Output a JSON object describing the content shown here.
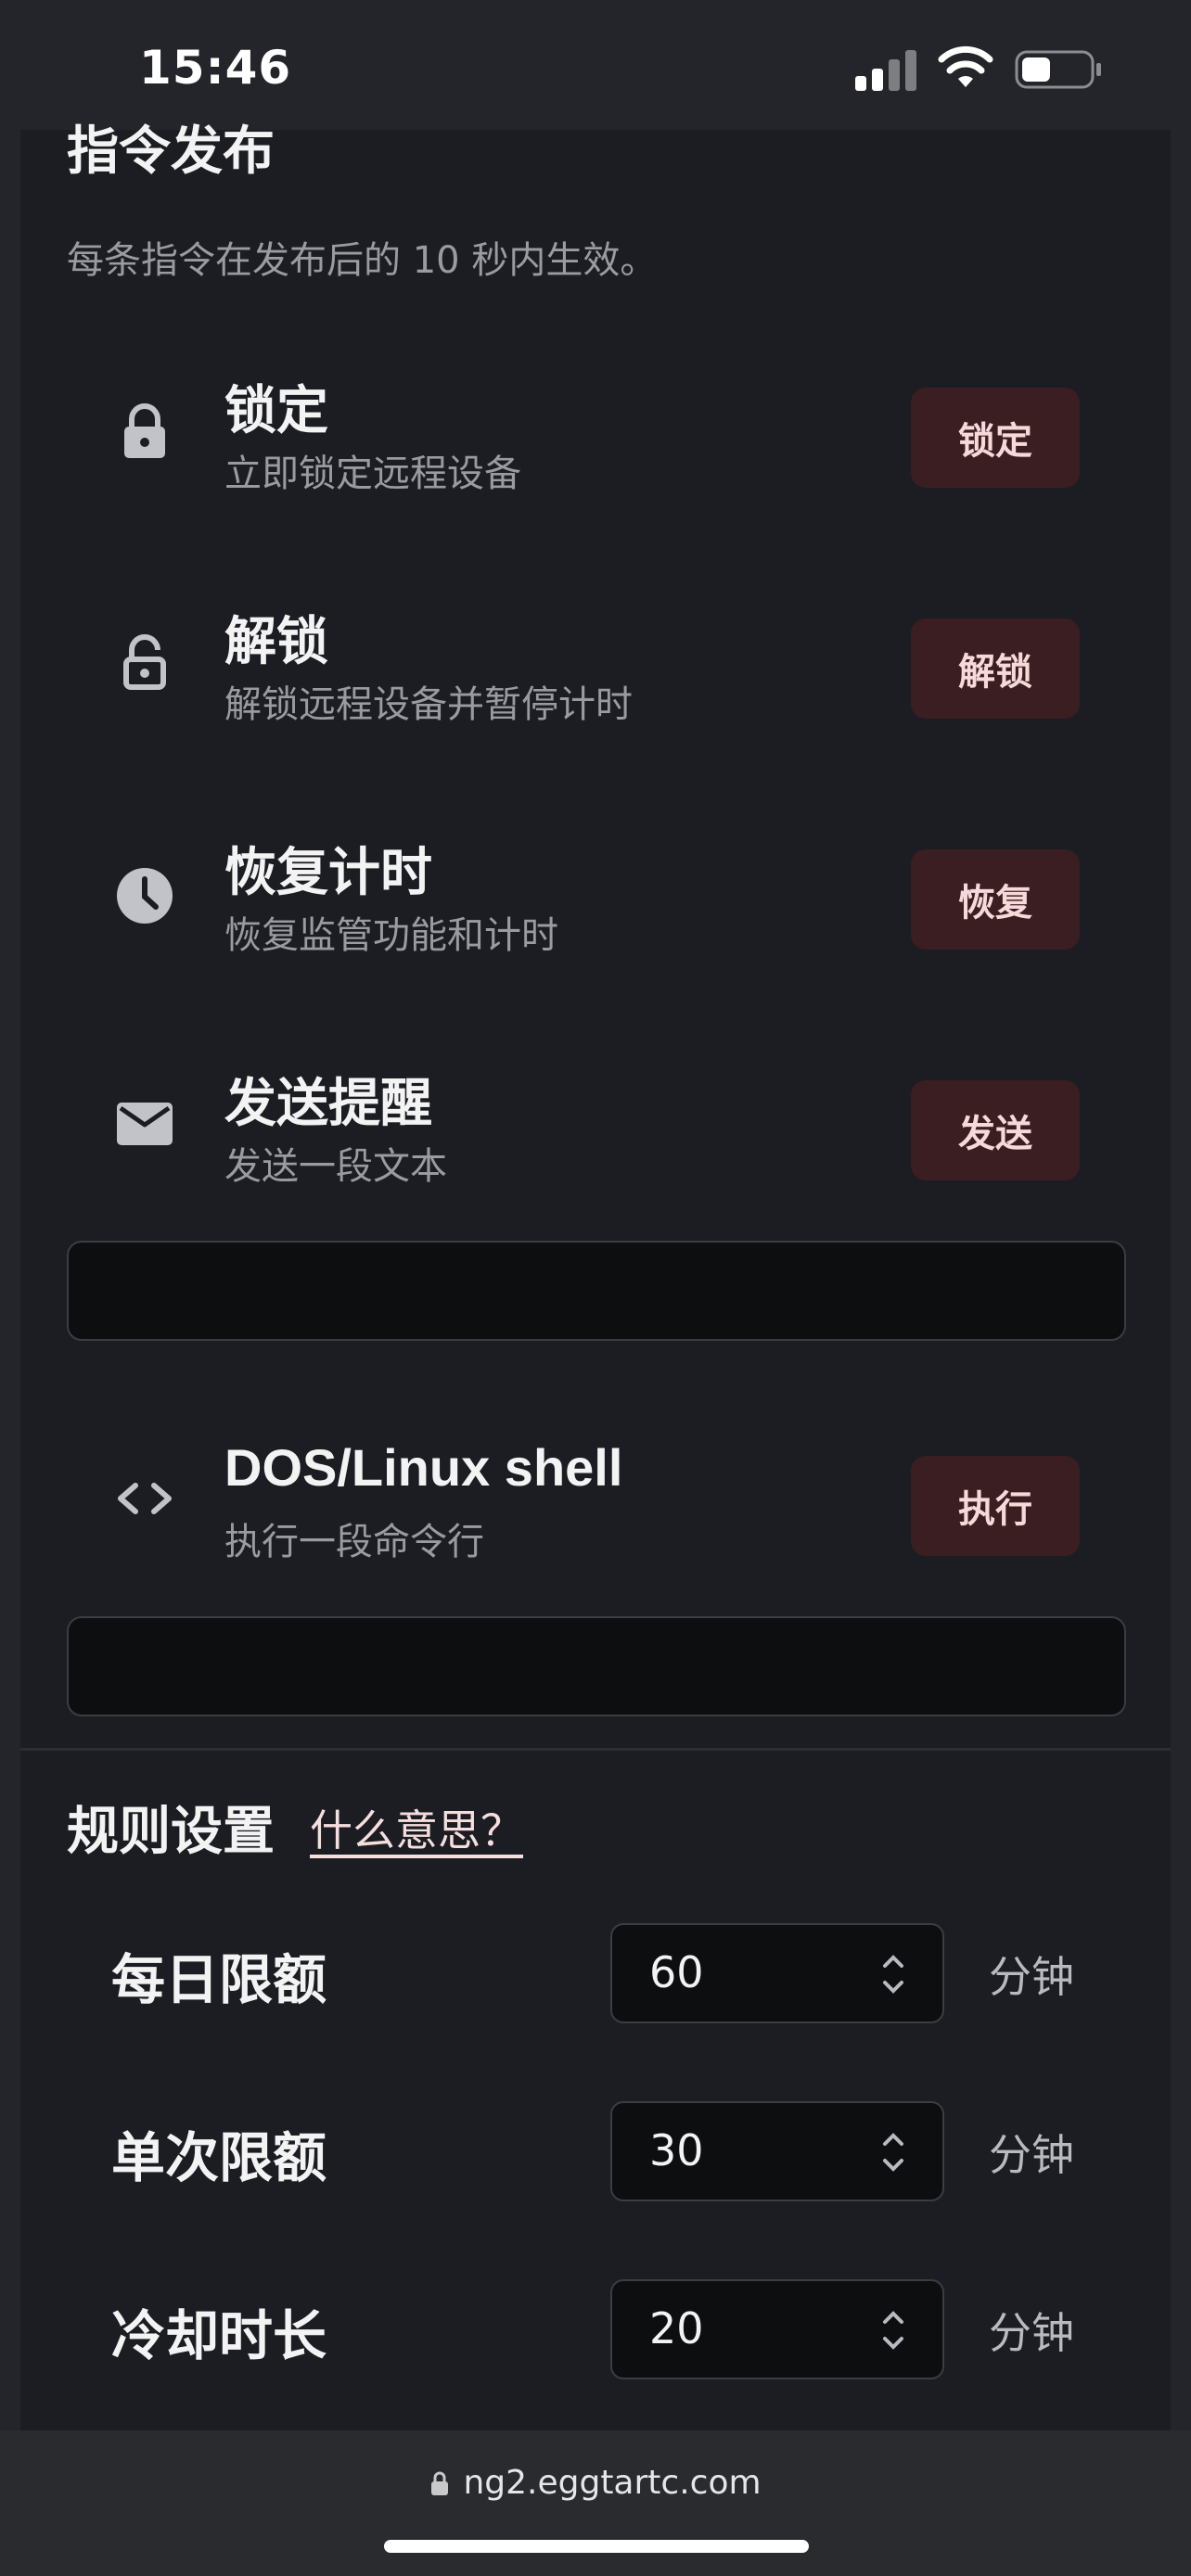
{
  "status_bar": {
    "time": "15:46"
  },
  "commands_section": {
    "title": "指令发布",
    "description": "每条指令在发布后的 10 秒内生效。",
    "items": [
      {
        "icon": "lock-icon",
        "title": "锁定",
        "subtitle": "立即锁定远程设备",
        "button": "锁定"
      },
      {
        "icon": "unlock-icon",
        "title": "解锁",
        "subtitle": "解锁远程设备并暂停计时",
        "button": "解锁"
      },
      {
        "icon": "clock-icon",
        "title": "恢复计时",
        "subtitle": "恢复监管功能和计时",
        "button": "恢复"
      },
      {
        "icon": "mail-icon",
        "title": "发送提醒",
        "subtitle": "发送一段文本",
        "button": "发送"
      },
      {
        "icon": "code-icon",
        "title": "DOS/Linux shell",
        "subtitle": "执行一段命令行",
        "button": "执行"
      }
    ],
    "reminder_input": {
      "value": ""
    },
    "shell_input": {
      "value": ""
    }
  },
  "rules_section": {
    "title": "规则设置",
    "help_link": "什么意思？",
    "rules": [
      {
        "label": "每日限额",
        "value": "60",
        "unit": "分钟"
      },
      {
        "label": "单次限额",
        "value": "30",
        "unit": "分钟"
      },
      {
        "label": "冷却时长",
        "value": "20",
        "unit": "分钟"
      }
    ]
  },
  "browser": {
    "url": "ng2.eggtartc.com"
  },
  "colors": {
    "accent_button_bg": "#3a1e21",
    "panel_bg": "#1b1d22",
    "page_bg": "#24252a"
  }
}
